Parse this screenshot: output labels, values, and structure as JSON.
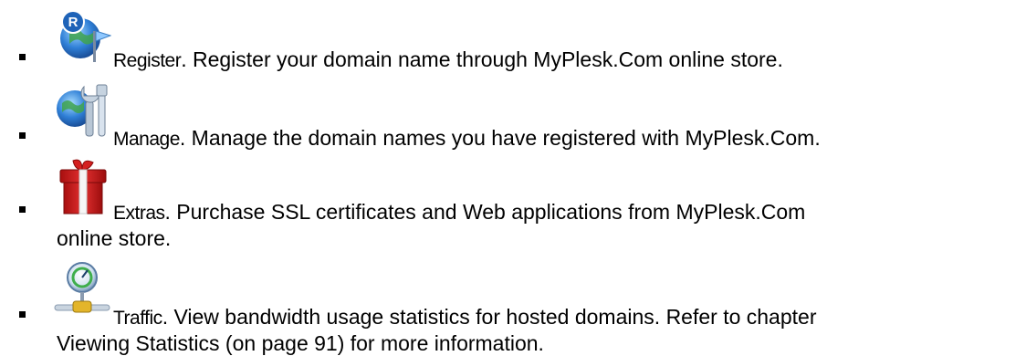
{
  "items": [
    {
      "icon": "register-globe-flag-icon",
      "label": "Register",
      "text": ". Register your domain name through MyPlesk.Com online store.",
      "text2": ""
    },
    {
      "icon": "manage-globe-tools-icon",
      "label": "Manage",
      "text": ". Manage the domain names you have registered with MyPlesk.Com.",
      "text2": ""
    },
    {
      "icon": "extras-gift-icon",
      "label": "Extras",
      "text": ". Purchase SSL certificates and Web applications from MyPlesk.Com",
      "text2": "online store."
    },
    {
      "icon": "traffic-gauge-icon",
      "label": "Traffic",
      "text": ". View bandwidth usage statistics for hosted domains. Refer to chapter",
      "text2": "Viewing Statistics (on page 91) for more information."
    }
  ],
  "colors": {
    "text": "#000000",
    "gift_red": "#d42020",
    "globe_blue": "#2f7fd6",
    "badge_blue": "#1e63b8"
  }
}
